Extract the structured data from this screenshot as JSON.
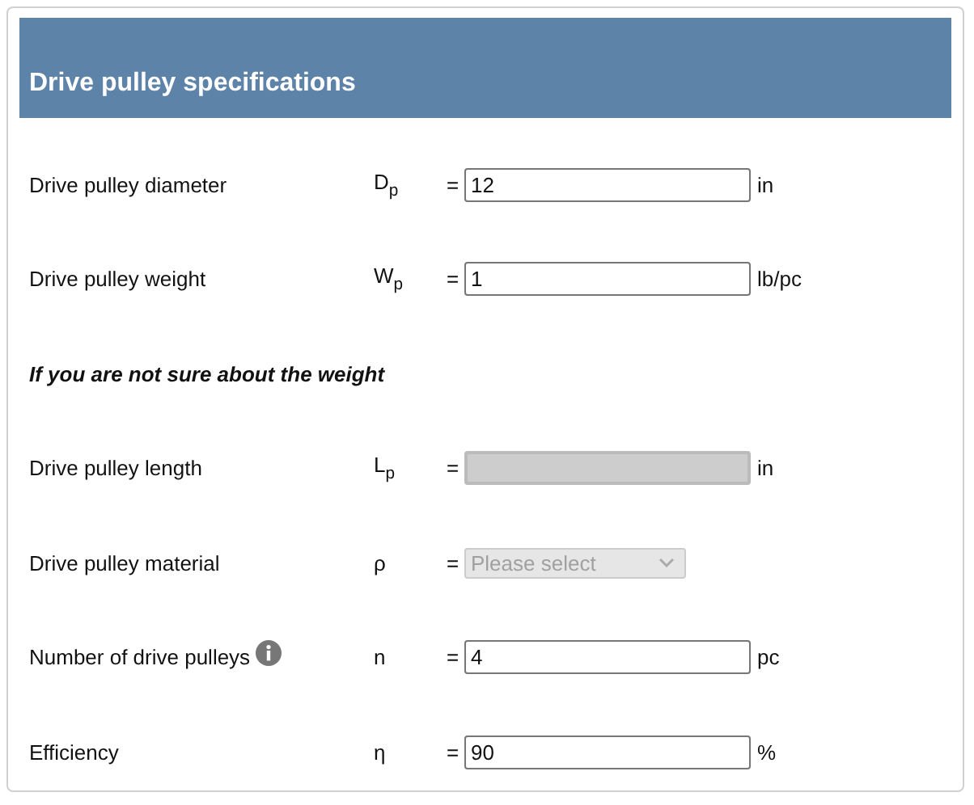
{
  "section": {
    "title": "Drive pulley specifications"
  },
  "rows": [
    {
      "kind": "input",
      "label": "Drive pulley diameter",
      "symbol": "D$_{p}$",
      "equals": "=",
      "value": "12",
      "unit": "in",
      "disabled": false,
      "info": false
    },
    {
      "kind": "input",
      "label": "Drive pulley weight",
      "symbol": "W$_{p}$",
      "equals": "=",
      "value": "1",
      "unit": "lb/pc",
      "disabled": false,
      "info": false
    },
    {
      "kind": "note",
      "label": "If you are not sure about the weight"
    },
    {
      "kind": "input",
      "label": "Drive pulley length",
      "symbol": "L$_{p}$",
      "equals": "=",
      "unit": "in",
      "disabled": true,
      "info": false
    },
    {
      "kind": "select",
      "label": "Drive pulley material",
      "symbol": "ρ",
      "equals": "=",
      "placeholder": "Please select",
      "disabled": true,
      "info": false
    },
    {
      "kind": "input",
      "label": "Number of drive pulleys",
      "symbol": "n",
      "equals": "=",
      "value": "4",
      "unit": "pc",
      "disabled": false,
      "info": true
    },
    {
      "kind": "input",
      "label": "Efficiency",
      "symbol": "η",
      "equals": "=",
      "value": "90",
      "unit": "%",
      "disabled": false,
      "info": false
    }
  ]
}
